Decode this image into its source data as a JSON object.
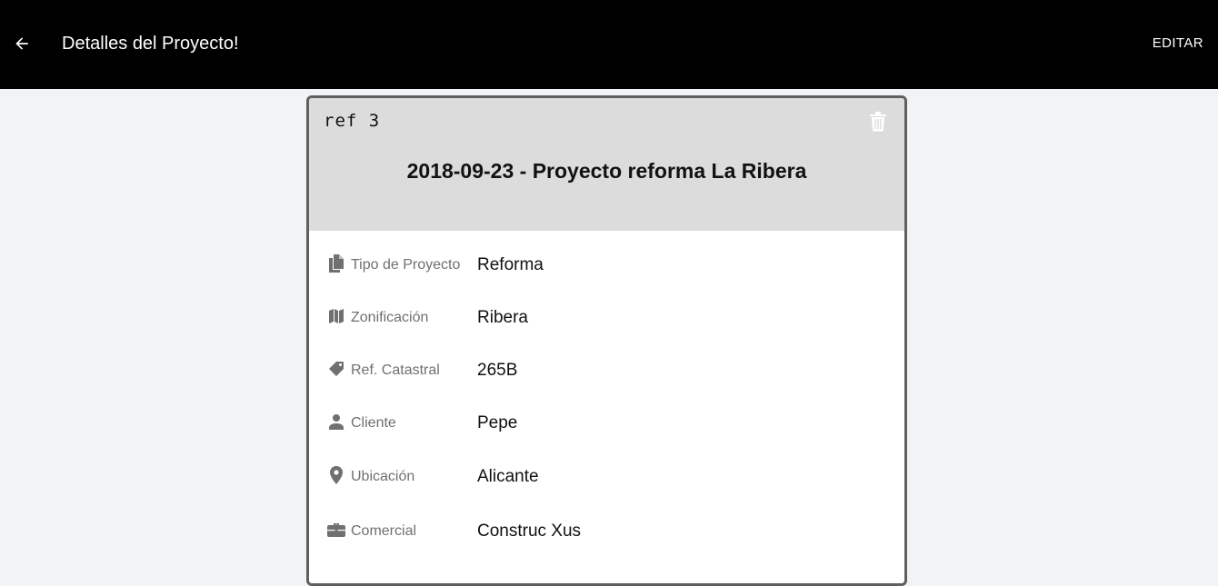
{
  "appbar": {
    "back_icon": "arrow-left-icon",
    "title": "Detalles del Proyecto!",
    "edit_label": "EDITAR"
  },
  "card": {
    "ref": "ref 3",
    "delete_icon": "trash-icon",
    "title": "2018-09-23 - Proyecto reforma La Ribera",
    "fields": [
      {
        "icon": "documents-icon",
        "label": "Tipo de Proyecto",
        "value": "Reforma"
      },
      {
        "icon": "map-icon",
        "label": "Zonificación",
        "value": "Ribera"
      },
      {
        "icon": "tag-icon",
        "label": "Ref. Catastral",
        "value": "265B"
      },
      {
        "icon": "person-icon",
        "label": "Cliente",
        "value": "Pepe"
      },
      {
        "icon": "location-pin-icon",
        "label": "Ubicación",
        "value": "Alicante"
      },
      {
        "icon": "briefcase-icon",
        "label": "Comercial",
        "value": "Construc Xus"
      }
    ]
  },
  "colors": {
    "appbar_bg": "#000000",
    "page_bg": "#f2f3f7",
    "card_header_bg": "#dcdcdc",
    "card_border": "#5f5f5f",
    "label_color": "#707070"
  }
}
